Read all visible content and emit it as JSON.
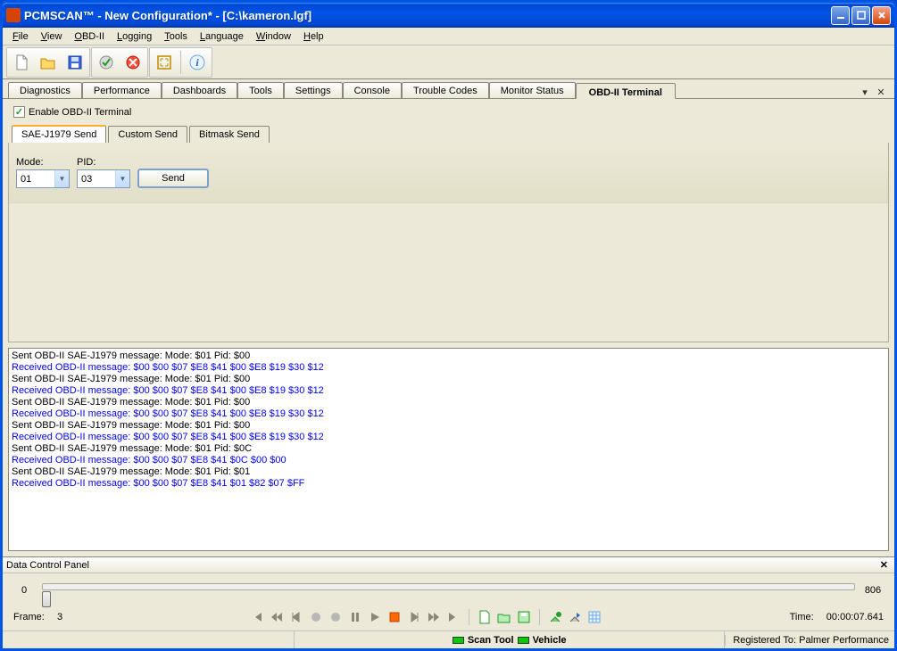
{
  "window": {
    "title": "PCMSCAN™ - New Configuration* - [C:\\kameron.lgf]"
  },
  "menubar": [
    "File",
    "View",
    "OBD-II",
    "Logging",
    "Tools",
    "Language",
    "Window",
    "Help"
  ],
  "tabs": [
    "Diagnostics",
    "Performance",
    "Dashboards",
    "Tools",
    "Settings",
    "Console",
    "Trouble Codes",
    "Monitor Status",
    "OBD-II Terminal"
  ],
  "active_tab": "OBD-II Terminal",
  "enable_terminal": {
    "label": "Enable OBD-II Terminal",
    "checked": true
  },
  "subtabs": [
    "SAE-J1979 Send",
    "Custom Send",
    "Bitmask Send"
  ],
  "active_subtab": "SAE-J1979 Send",
  "send_form": {
    "mode_label": "Mode:",
    "mode_value": "01",
    "pid_label": "PID:",
    "pid_value": "03",
    "send_label": "Send"
  },
  "log": [
    {
      "type": "sent",
      "text": "Sent OBD-II SAE-J1979 message: Mode: $01 Pid: $00"
    },
    {
      "type": "recv",
      "text": "Received OBD-II message: $00 $00 $07 $E8 $41 $00 $E8 $19 $30 $12"
    },
    {
      "type": "sent",
      "text": "Sent OBD-II SAE-J1979 message: Mode: $01 Pid: $00"
    },
    {
      "type": "recv",
      "text": "Received OBD-II message: $00 $00 $07 $E8 $41 $00 $E8 $19 $30 $12"
    },
    {
      "type": "sent",
      "text": "Sent OBD-II SAE-J1979 message: Mode: $01 Pid: $00"
    },
    {
      "type": "recv",
      "text": "Received OBD-II message: $00 $00 $07 $E8 $41 $00 $E8 $19 $30 $12"
    },
    {
      "type": "sent",
      "text": "Sent OBD-II SAE-J1979 message: Mode: $01 Pid: $00"
    },
    {
      "type": "recv",
      "text": "Received OBD-II message: $00 $00 $07 $E8 $41 $00 $E8 $19 $30 $12"
    },
    {
      "type": "sent",
      "text": "Sent OBD-II SAE-J1979 message: Mode: $01 Pid: $0C"
    },
    {
      "type": "recv",
      "text": "Received OBD-II message: $00 $00 $07 $E8 $41 $0C $00 $00"
    },
    {
      "type": "sent",
      "text": "Sent OBD-II SAE-J1979 message: Mode: $01 Pid: $01"
    },
    {
      "type": "recv",
      "text": "Received OBD-II message: $00 $00 $07 $E8 $41 $01 $82 $07 $FF"
    }
  ],
  "dcp": {
    "title": "Data Control Panel",
    "min": "0",
    "max": "806",
    "frame_label": "Frame:",
    "frame_value": "3",
    "time_label": "Time:",
    "time_value": "00:00:07.641"
  },
  "statusbar": {
    "scan_tool": "Scan Tool",
    "vehicle": "Vehicle",
    "registered": "Registered To: Palmer Performance"
  }
}
